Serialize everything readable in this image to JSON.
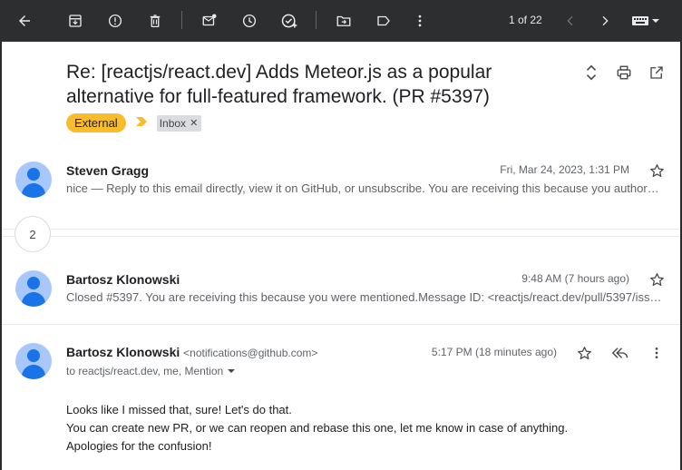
{
  "toolbar": {
    "icons": [
      "back-arrow-icon",
      "archive-icon",
      "report-spam-icon",
      "delete-icon",
      "mark-unread-icon",
      "snooze-icon",
      "add-to-tasks-icon",
      "move-to-icon",
      "label-icon",
      "more-icon"
    ],
    "pager_text": "1 of 22"
  },
  "subject": "Re: [reactjs/react.dev] Adds Meteor.js as a popular alternative for full-featured framework. (PR #5397)",
  "labels": {
    "external": "External",
    "inbox": "Inbox"
  },
  "messages": [
    {
      "sender": "Steven Gragg",
      "date": "Fri, Mar 24, 2023, 1:31 PM",
      "snippet": "nice — Reply to this email directly, view it on GitHub, or unsubscribe. You are receiving this because you authored the thread."
    },
    {
      "sender": "Bartosz Klonowski",
      "date": "9:48 AM (7 hours ago)",
      "snippet": "Closed #5397. You are receiving this because you were mentioned.Message ID: <reactjs/react.dev/pull/5397/issue_event>"
    }
  ],
  "collapsed_count": "2",
  "expanded": {
    "sender": "Bartosz Klonowski",
    "email": "<notifications@github.com>",
    "date": "5:17 PM (18 minutes ago)",
    "to": "to reactjs/react.dev, me, Mention",
    "body": [
      "Looks like I missed that, sure! Let's do that.",
      "You can create new PR, or we can reopen and rebase this one, let me know in case of anything.",
      "Apologies for the confusion!"
    ]
  },
  "colors": {
    "toolbar_bg": "#2d2e30",
    "external_label": "#f9bd2c",
    "avatar_bg": "#a8c7fa",
    "avatar_fg": "#1a73e8"
  }
}
